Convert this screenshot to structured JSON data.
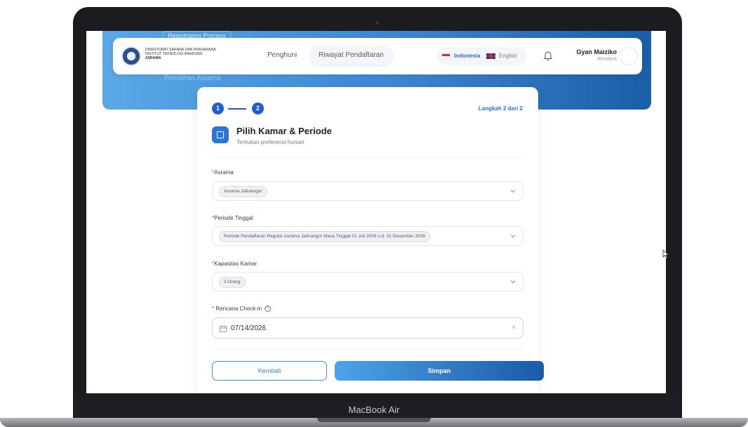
{
  "device": {
    "label": "MacBook Air"
  },
  "hero": {
    "tag": "Registration Process",
    "ghost_text": "Pemilihan Asrama"
  },
  "header": {
    "logo_line1": "DIREKTORAT SARANA DAN PRASARANA",
    "logo_line2": "INSTITUT TEKNOLOGI BANDUNG",
    "logo_line3": "ASRAMA",
    "nav": [
      "Penghuni",
      "Riwayat Pendaftaran"
    ],
    "languages": {
      "active": "Indonesia",
      "other": "English"
    },
    "user": {
      "name": "Gyan Maiziko",
      "role": "Resident"
    }
  },
  "stepper": {
    "steps": [
      "1",
      "2"
    ],
    "info": "Langkah 2 dari 2"
  },
  "section": {
    "title": "Pilih Kamar & Periode",
    "subtitle": "Tentukan preferensi hunian"
  },
  "form": {
    "asrama": {
      "label": "Asrama",
      "value": "Asrama Jatinangor"
    },
    "periode": {
      "label": "Periode Tinggal",
      "value": "Periode Pendaftaran Regular Asrama Jatinangor Masa Tinggal 01 Juli 2026 s.d. 31 Desember 2026"
    },
    "kapasitas": {
      "label": "Kapasitas Kamar",
      "value": "3 Orang"
    },
    "checkin": {
      "label": "Rencana Check-in",
      "help": "?",
      "value": "07/14/2026",
      "clear": "×"
    },
    "required_mark": "*"
  },
  "actions": {
    "back": "Kembali",
    "save": "Simpan"
  },
  "colors": {
    "primary": "#1e5fcf",
    "accent": "#2a76d2",
    "hero_start": "#5aa8e6",
    "hero_end": "#1b5ea8"
  }
}
